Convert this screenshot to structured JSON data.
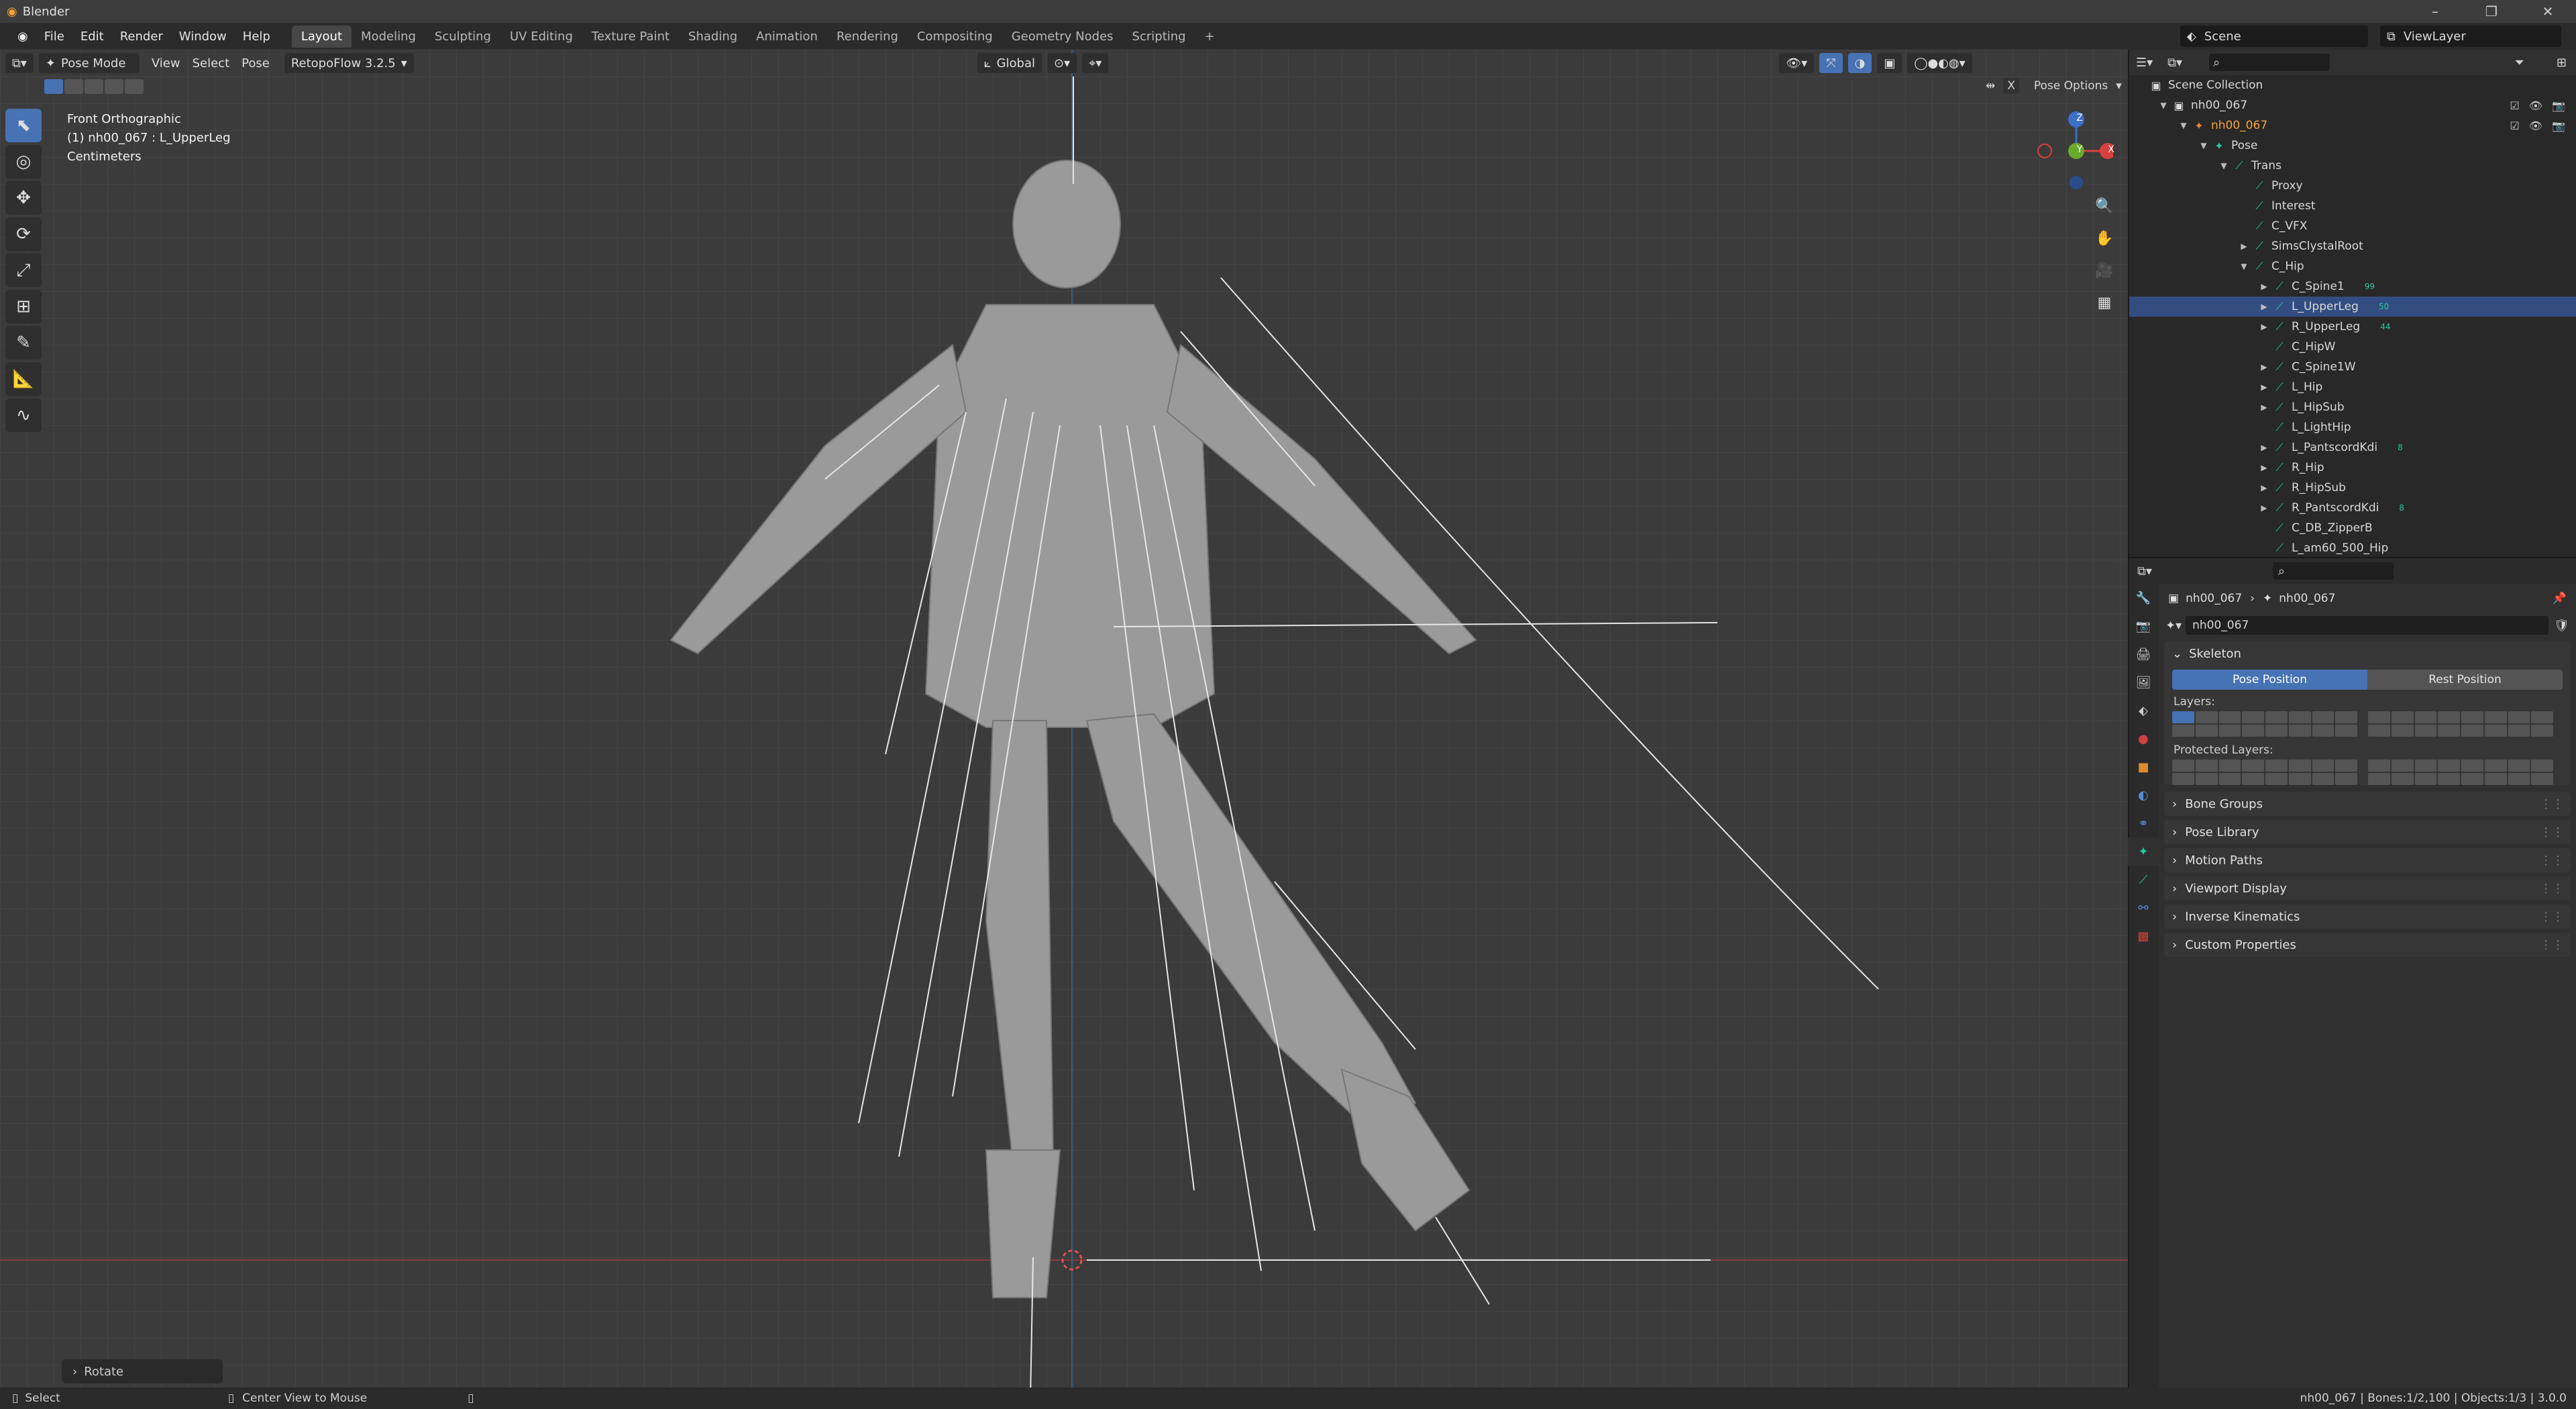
{
  "app": {
    "title": "Blender",
    "window_controls": [
      "–",
      "❐",
      "✕"
    ]
  },
  "menu": [
    "File",
    "Edit",
    "Render",
    "Window",
    "Help"
  ],
  "workspaces": {
    "tabs": [
      "Layout",
      "Modeling",
      "Sculpting",
      "UV Editing",
      "Texture Paint",
      "Shading",
      "Animation",
      "Rendering",
      "Compositing",
      "Geometry Nodes",
      "Scripting"
    ],
    "active": "Layout",
    "add": "+"
  },
  "scene": {
    "name": "Scene",
    "view_layer": "ViewLayer"
  },
  "viewport": {
    "mode": "Pose Mode",
    "menus": [
      "View",
      "Select",
      "Pose"
    ],
    "addon": "RetopoFlow 3.2.5",
    "orientation": "Global",
    "pose_options": "Pose Options",
    "x_axis": "X",
    "view_name": "Front Orthographic",
    "active_object": "(1) nh00_067 : L_UpperLeg",
    "units": "Centimeters",
    "gizmo": {
      "z": "Z",
      "y": "Y",
      "x": "X"
    },
    "last_op": "Rotate"
  },
  "tools": [
    "select-box",
    "cursor",
    "move",
    "rotate",
    "scale",
    "transform",
    "annotate",
    "measure",
    "bone-relax"
  ],
  "outliner": {
    "root": "Scene Collection",
    "rows": [
      {
        "label": "nh00_067",
        "depth": 1,
        "type": "collection",
        "expanded": true
      },
      {
        "label": "nh00_067",
        "depth": 2,
        "type": "armature",
        "expanded": true,
        "highlight": true
      },
      {
        "label": "Pose",
        "depth": 3,
        "type": "pose",
        "expanded": true
      },
      {
        "label": "Trans",
        "depth": 4,
        "type": "bone",
        "expanded": true
      },
      {
        "label": "Proxy",
        "depth": 5,
        "type": "bone"
      },
      {
        "label": "Interest",
        "depth": 5,
        "type": "bone"
      },
      {
        "label": "C_VFX",
        "depth": 5,
        "type": "bone"
      },
      {
        "label": "SimsClystalRoot",
        "depth": 5,
        "type": "bone",
        "collapsed": true
      },
      {
        "label": "C_Hip",
        "depth": 5,
        "type": "bone",
        "expanded": true
      },
      {
        "label": "C_Spine1",
        "depth": 6,
        "type": "bone",
        "collapsed": true,
        "count": "99"
      },
      {
        "label": "L_UpperLeg",
        "depth": 6,
        "type": "bone",
        "collapsed": true,
        "count": "50",
        "selected": true
      },
      {
        "label": "R_UpperLeg",
        "depth": 6,
        "type": "bone",
        "collapsed": true,
        "count": "44"
      },
      {
        "label": "C_HipW",
        "depth": 6,
        "type": "bone"
      },
      {
        "label": "C_Spine1W",
        "depth": 6,
        "type": "bone",
        "collapsed": true
      },
      {
        "label": "L_Hip",
        "depth": 6,
        "type": "bone",
        "collapsed": true
      },
      {
        "label": "L_HipSub",
        "depth": 6,
        "type": "bone",
        "collapsed": true
      },
      {
        "label": "L_LightHip",
        "depth": 6,
        "type": "bone"
      },
      {
        "label": "L_PantscordKdi",
        "depth": 6,
        "type": "bone",
        "collapsed": true,
        "count": "8"
      },
      {
        "label": "R_Hip",
        "depth": 6,
        "type": "bone",
        "collapsed": true
      },
      {
        "label": "R_HipSub",
        "depth": 6,
        "type": "bone",
        "collapsed": true
      },
      {
        "label": "R_PantscordKdi",
        "depth": 6,
        "type": "bone",
        "collapsed": true,
        "count": "8"
      },
      {
        "label": "C_DB_ZipperB",
        "depth": 6,
        "type": "bone"
      },
      {
        "label": "L_am60_500_Hip",
        "depth": 6,
        "type": "bone"
      }
    ]
  },
  "properties": {
    "breadcrumb": [
      "nh00_067",
      "nh00_067"
    ],
    "data_name": "nh00_067",
    "skeleton": {
      "title": "Skeleton",
      "pose_position": "Pose Position",
      "rest_position": "Rest Position",
      "layers_label": "Layers:",
      "protected_label": "Protected Layers:"
    },
    "panels": [
      "Bone Groups",
      "Pose Library",
      "Motion Paths",
      "Viewport Display",
      "Inverse Kinematics",
      "Custom Properties"
    ]
  },
  "status": {
    "left": "Select",
    "middle": "Center View to Mouse",
    "right": "nh00_067 | Bones:1/2,100 | Objects:1/3 | 3.0.0"
  },
  "colors": {
    "accent": "#4772b3",
    "bone": "#27c7a0",
    "viewport_bg": "#3b3b3b"
  }
}
